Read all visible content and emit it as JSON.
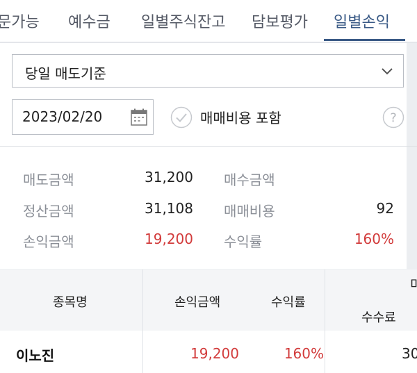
{
  "tabs": [
    {
      "label": "문가능",
      "active": false
    },
    {
      "label": "예수금",
      "active": false
    },
    {
      "label": "일별주식잔고",
      "active": false
    },
    {
      "label": "담보평가",
      "active": false
    },
    {
      "label": "일별손익",
      "active": true
    }
  ],
  "filter": {
    "basis_select": "당일 매도기준",
    "date": "2023/02/20",
    "include_fees_label": "매매비용 포함"
  },
  "summary": {
    "sell_amount_label": "매도금액",
    "sell_amount_value": "31,200",
    "buy_amount_label": "매수금액",
    "buy_amount_value": "",
    "settle_amount_label": "정산금액",
    "settle_amount_value": "31,108",
    "fee_label": "매매비용",
    "fee_value": "92",
    "pnl_amount_label": "손익금액",
    "pnl_amount_value": "19,200",
    "return_label": "수익률",
    "return_value": "160%"
  },
  "table": {
    "headers": {
      "name": "종목명",
      "pnl": "손익금액",
      "return": "수익률",
      "fee_top": "미",
      "fee": "수수료"
    },
    "rows": [
      {
        "name": "이노진",
        "pnl": "19,200",
        "return": "160%",
        "fee": "30"
      }
    ]
  },
  "colors": {
    "accent": "#3a5a86",
    "profit_red": "#d23b3b",
    "label_gray": "#8b8f97"
  }
}
